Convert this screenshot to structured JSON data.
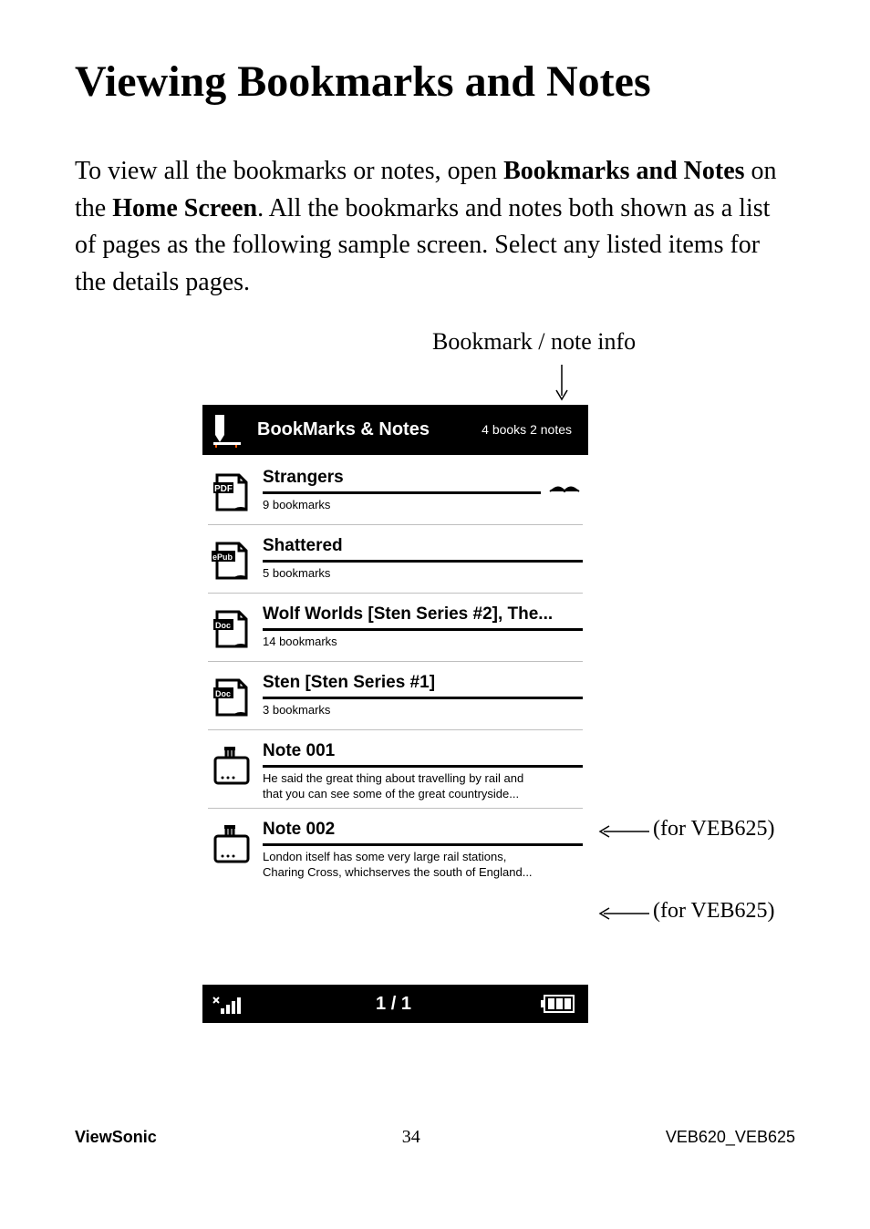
{
  "heading": "Viewing Bookmarks and Notes",
  "intro": {
    "t1": "To view all the bookmarks or notes, open ",
    "b1": "Bookmarks and Notes",
    "t2": " on the ",
    "b2": "Home Screen",
    "t3": ".  All the bookmarks and notes both shown as a list of pages as the following sample screen. Select any listed items for the details pages."
  },
  "callouts": {
    "top": "Bookmark / note info",
    "right1": "(for VEB625)",
    "right2": "(for VEB625)"
  },
  "device": {
    "header": {
      "title": "BookMarks & Notes",
      "info": "4 books 2 notes"
    },
    "items": [
      {
        "icon_label": "PDF",
        "title": "Strangers",
        "sub": "9 bookmarks",
        "trail": "reading"
      },
      {
        "icon_label": "ePub",
        "title": "Shattered",
        "sub": "5 bookmarks"
      },
      {
        "icon_label": "Doc",
        "title": "Wolf Worlds [Sten Series #2], The...",
        "sub": "14 bookmarks"
      },
      {
        "icon_label": "Doc",
        "title": "Sten [Sten Series #1]",
        "sub": "3 bookmarks"
      },
      {
        "icon_label": "note",
        "title": "Note 001",
        "sub": "He said the great thing about travelling by rail and",
        "sub2": "that you can see some of the great countryside..."
      },
      {
        "icon_label": "note",
        "title": "Note 002",
        "sub": "London itself has some very large rail stations,",
        "sub2": "Charing Cross, whichserves the south of England..."
      }
    ],
    "footer": {
      "page": "1 / 1"
    }
  },
  "page_footer": {
    "left": "ViewSonic",
    "center": "34",
    "right": "VEB620_VEB625"
  }
}
